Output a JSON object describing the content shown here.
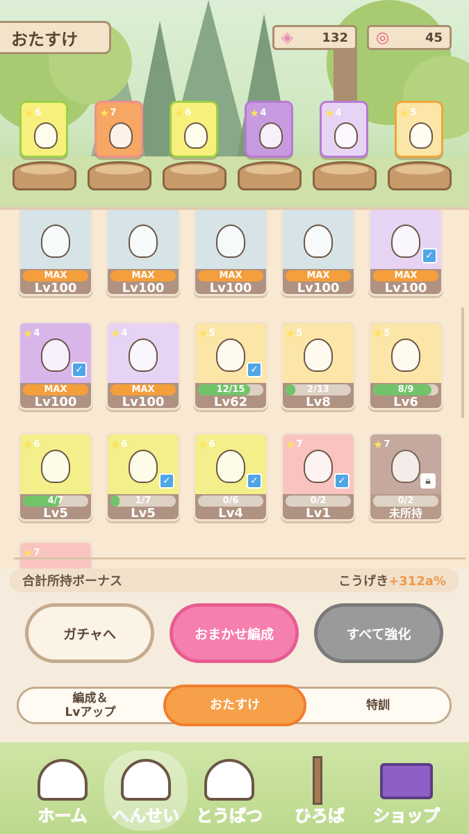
{
  "header": {
    "title": "おたすけ",
    "candy_count": "132",
    "lollipop_count": "45"
  },
  "helpers": [
    {
      "stars": "6",
      "color": "#f7f07c",
      "border": "#9ccf46"
    },
    {
      "stars": "7",
      "color": "#f6a763",
      "border": "#f18e8e"
    },
    {
      "stars": "6",
      "color": "#f7f07c",
      "border": "#9ccf46"
    },
    {
      "stars": "4",
      "color": "#c89adf",
      "border": "#b77ad3"
    },
    {
      "stars": "4",
      "color": "#e7d3f3",
      "border": "#b77ad3"
    },
    {
      "stars": "5",
      "color": "#fbe6a8",
      "border": "#f0a43c"
    }
  ],
  "cards": [
    {
      "bar": "MAX",
      "lv": "Lv100",
      "bg": "#d6e4e8",
      "max": true,
      "check": false
    },
    {
      "bar": "MAX",
      "lv": "Lv100",
      "bg": "#d6e4e8",
      "max": true,
      "check": false
    },
    {
      "bar": "MAX",
      "lv": "Lv100",
      "bg": "#d6e4e8",
      "max": true,
      "check": false
    },
    {
      "bar": "MAX",
      "lv": "Lv100",
      "bg": "#d6e4e8",
      "max": true,
      "check": false
    },
    {
      "bar": "MAX",
      "lv": "Lv100",
      "bg": "#e7d3f3",
      "max": true,
      "check": true
    },
    {
      "stars": "4",
      "bar": "MAX",
      "lv": "Lv100",
      "bg": "#d9b6ea",
      "max": true,
      "check": true
    },
    {
      "stars": "4",
      "bar": "MAX",
      "lv": "Lv100",
      "bg": "#e7d3f3",
      "max": true,
      "check": false
    },
    {
      "stars": "5",
      "bar": "12/15",
      "lv": "Lv62",
      "bg": "#fbe6a8",
      "progress": 0.8,
      "check": true
    },
    {
      "stars": "5",
      "bar": "2/13",
      "lv": "Lv8",
      "bg": "#fbe6a8",
      "progress": 0.15,
      "check": false
    },
    {
      "stars": "5",
      "bar": "8/9",
      "lv": "Lv6",
      "bg": "#fbe6a8",
      "progress": 0.89,
      "check": false
    },
    {
      "stars": "6",
      "bar": "4/7",
      "lv": "Lv5",
      "bg": "#f3ef8a",
      "progress": 0.57,
      "check": false
    },
    {
      "stars": "6",
      "bar": "1/7",
      "lv": "Lv5",
      "bg": "#f3ef8a",
      "progress": 0.14,
      "check": true
    },
    {
      "stars": "6",
      "bar": "0/6",
      "lv": "Lv4",
      "bg": "#f3ef8a",
      "progress": 0,
      "check": true
    },
    {
      "stars": "7",
      "bar": "0/2",
      "lv": "Lv1",
      "bg": "#f9c4c0",
      "progress": 0,
      "check": true
    },
    {
      "stars": "7",
      "bar": "0/2",
      "lv": "未所持",
      "bg": "#c0a39a",
      "progress": 0,
      "check": false,
      "locked": true
    }
  ],
  "partial_card": {
    "stars": "7"
  },
  "bonus": {
    "label": "合計所持ボーナス",
    "value_prefix": "こうげき",
    "value": "+312a%"
  },
  "buttons": {
    "gacha": "ガチャへ",
    "auto": "おまかせ編成",
    "upgrade_all": "すべて強化"
  },
  "tabs": [
    {
      "line1": "編成＆",
      "line2": "Lvアップ"
    },
    {
      "label": "おたすけ"
    },
    {
      "label": "特訓"
    }
  ],
  "nav": [
    {
      "label": "ホーム",
      "color": "#e76d3a",
      "icon": "house-icon"
    },
    {
      "label": "へんせい",
      "color": "#4b90d6",
      "icon": "characters-icon"
    },
    {
      "label": "とうばつ",
      "color": "#e3557a",
      "icon": "slingshot-icon"
    },
    {
      "label": "ひろば",
      "color": "#6a58a8",
      "icon": "signpost-icon"
    },
    {
      "label": "ショップ",
      "color": "#8a56c2",
      "icon": "shop-icon"
    }
  ],
  "colors": {
    "accent": "#f4a23e",
    "pink": "#f176a5",
    "gray": "#8f8f8f"
  }
}
